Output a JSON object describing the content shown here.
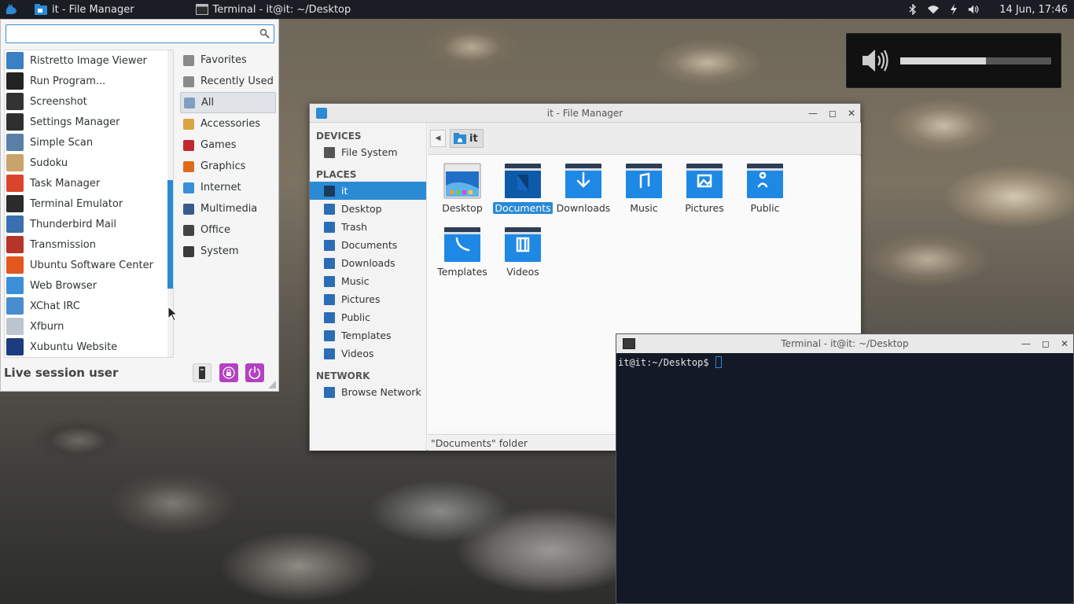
{
  "panel": {
    "tasks": [
      {
        "label": "it - File Manager",
        "icon": "folder-icon"
      },
      {
        "label": "Terminal - it@it: ~/Desktop",
        "icon": "terminal-icon"
      }
    ],
    "clock": "14 Jun, 17:46"
  },
  "whisker_menu": {
    "search_value": "",
    "apps": [
      {
        "label": "Ristretto Image Viewer",
        "color": "#3b7fc4"
      },
      {
        "label": "Run Program...",
        "color": "#222222"
      },
      {
        "label": "Screenshot",
        "color": "#333333"
      },
      {
        "label": "Settings Manager",
        "color": "#2f2f2f"
      },
      {
        "label": "Simple Scan",
        "color": "#5a7fa8"
      },
      {
        "label": "Sudoku",
        "color": "#c9a46a"
      },
      {
        "label": "Task Manager",
        "color": "#d9452b"
      },
      {
        "label": "Terminal Emulator",
        "color": "#2b2b2b"
      },
      {
        "label": "Thunderbird Mail",
        "color": "#3a6fb0"
      },
      {
        "label": "Transmission",
        "color": "#b8332a"
      },
      {
        "label": "Ubuntu Software Center",
        "color": "#e2561f"
      },
      {
        "label": "Web Browser",
        "color": "#3b8ed8"
      },
      {
        "label": "XChat IRC",
        "color": "#4a8cd0"
      },
      {
        "label": "Xfburn",
        "color": "#bcc6d0"
      },
      {
        "label": "Xubuntu Website",
        "color": "#1c3c80"
      }
    ],
    "scroll_position": 0.65,
    "categories": [
      {
        "label": "Favorites",
        "color": "#8a8a8a",
        "selected": false
      },
      {
        "label": "Recently Used",
        "color": "#8a8a8a",
        "selected": false
      },
      {
        "label": "All",
        "color": "#7d9fc2",
        "selected": true
      },
      {
        "label": "Accessories",
        "color": "#d9a441",
        "selected": false
      },
      {
        "label": "Games",
        "color": "#c0282e",
        "selected": false
      },
      {
        "label": "Graphics",
        "color": "#e06a1c",
        "selected": false
      },
      {
        "label": "Internet",
        "color": "#3b8ed8",
        "selected": false
      },
      {
        "label": "Multimedia",
        "color": "#3a5a8c",
        "selected": false
      },
      {
        "label": "Office",
        "color": "#444444",
        "selected": false
      },
      {
        "label": "System",
        "color": "#3a3a3a",
        "selected": false
      }
    ],
    "user": "Live session user"
  },
  "file_manager": {
    "title": "it - File Manager",
    "sections": {
      "devices": "DEVICES",
      "places": "PLACES",
      "network": "NETWORK"
    },
    "devices": [
      {
        "label": "File System"
      }
    ],
    "places": [
      {
        "label": "it",
        "selected": true
      },
      {
        "label": "Desktop",
        "selected": false
      },
      {
        "label": "Trash",
        "selected": false
      },
      {
        "label": "Documents",
        "selected": false
      },
      {
        "label": "Downloads",
        "selected": false
      },
      {
        "label": "Music",
        "selected": false
      },
      {
        "label": "Pictures",
        "selected": false
      },
      {
        "label": "Public",
        "selected": false
      },
      {
        "label": "Templates",
        "selected": false
      },
      {
        "label": "Videos",
        "selected": false
      }
    ],
    "network": [
      {
        "label": "Browse Network"
      }
    ],
    "path": "it",
    "folders": [
      {
        "label": "Desktop",
        "selected": false
      },
      {
        "label": "Documents",
        "selected": true
      },
      {
        "label": "Downloads",
        "selected": false
      },
      {
        "label": "Music",
        "selected": false
      },
      {
        "label": "Pictures",
        "selected": false
      },
      {
        "label": "Public",
        "selected": false
      },
      {
        "label": "Templates",
        "selected": false
      },
      {
        "label": "Videos",
        "selected": false
      }
    ],
    "status": "\"Documents\" folder"
  },
  "terminal": {
    "title": "Terminal - it@it: ~/Desktop",
    "prompt": "it@it:~/Desktop$"
  },
  "volume_osd": {
    "level": 0.57
  }
}
